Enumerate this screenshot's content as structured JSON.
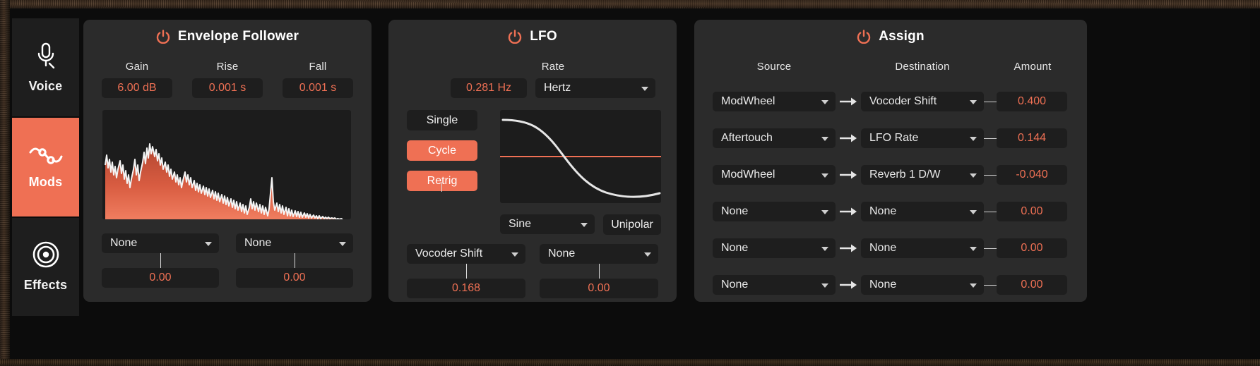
{
  "sidebar": {
    "items": [
      {
        "label": "Voice",
        "icon": "microphone-icon",
        "active": false
      },
      {
        "label": "Mods",
        "icon": "modulation-icon",
        "active": true
      },
      {
        "label": "Effects",
        "icon": "target-rings-icon",
        "active": false
      }
    ]
  },
  "envelope_follower": {
    "title": "Envelope Follower",
    "power_icon": "power-icon",
    "params": [
      {
        "label": "Gain",
        "value": "6.00 dB"
      },
      {
        "label": "Rise",
        "value": "0.001 s"
      },
      {
        "label": "Fall",
        "value": "0.001 s"
      }
    ],
    "mod_slots": [
      {
        "destination": "None",
        "amount": "0.00"
      },
      {
        "destination": "None",
        "amount": "0.00"
      }
    ],
    "graph": {
      "type": "area",
      "fill_color": "#e0664a",
      "line_color": "#f2f2f2",
      "description": "audio envelope follower waveform"
    }
  },
  "lfo": {
    "title": "LFO",
    "power_icon": "power-icon",
    "rate": {
      "label": "Rate",
      "value": "0.281 Hz",
      "unit": "Hertz"
    },
    "modes": [
      {
        "label": "Single",
        "active": false
      },
      {
        "label": "Cycle",
        "active": true
      },
      {
        "label": "Retrig",
        "active": true
      }
    ],
    "shape": "Sine",
    "polarity": "Unipolar",
    "graph": {
      "type": "line",
      "line_color": "#e6e6e6",
      "center_line_color": "#ef7054",
      "description": "sine LFO waveform, descending from peak"
    },
    "mod_slots": [
      {
        "destination": "Vocoder Shift",
        "amount": "0.168"
      },
      {
        "destination": "None",
        "amount": "0.00"
      }
    ]
  },
  "assign": {
    "title": "Assign",
    "power_icon": "power-icon",
    "columns": [
      "Source",
      "Destination",
      "Amount"
    ],
    "rows": [
      {
        "source": "ModWheel",
        "destination": "Vocoder Shift",
        "amount": "0.400"
      },
      {
        "source": "Aftertouch",
        "destination": "LFO Rate",
        "amount": "0.144"
      },
      {
        "source": "ModWheel",
        "destination": "Reverb 1 D/W",
        "amount": "-0.040"
      },
      {
        "source": "None",
        "destination": "None",
        "amount": "0.00"
      },
      {
        "source": "None",
        "destination": "None",
        "amount": "0.00"
      },
      {
        "source": "None",
        "destination": "None",
        "amount": "0.00"
      }
    ]
  },
  "colors": {
    "accent": "#ef7054",
    "panel_bg": "#2b2b2b",
    "control_bg": "#1e1e1e",
    "app_bg": "#0c0c0c",
    "text": "#e9e9e9"
  }
}
